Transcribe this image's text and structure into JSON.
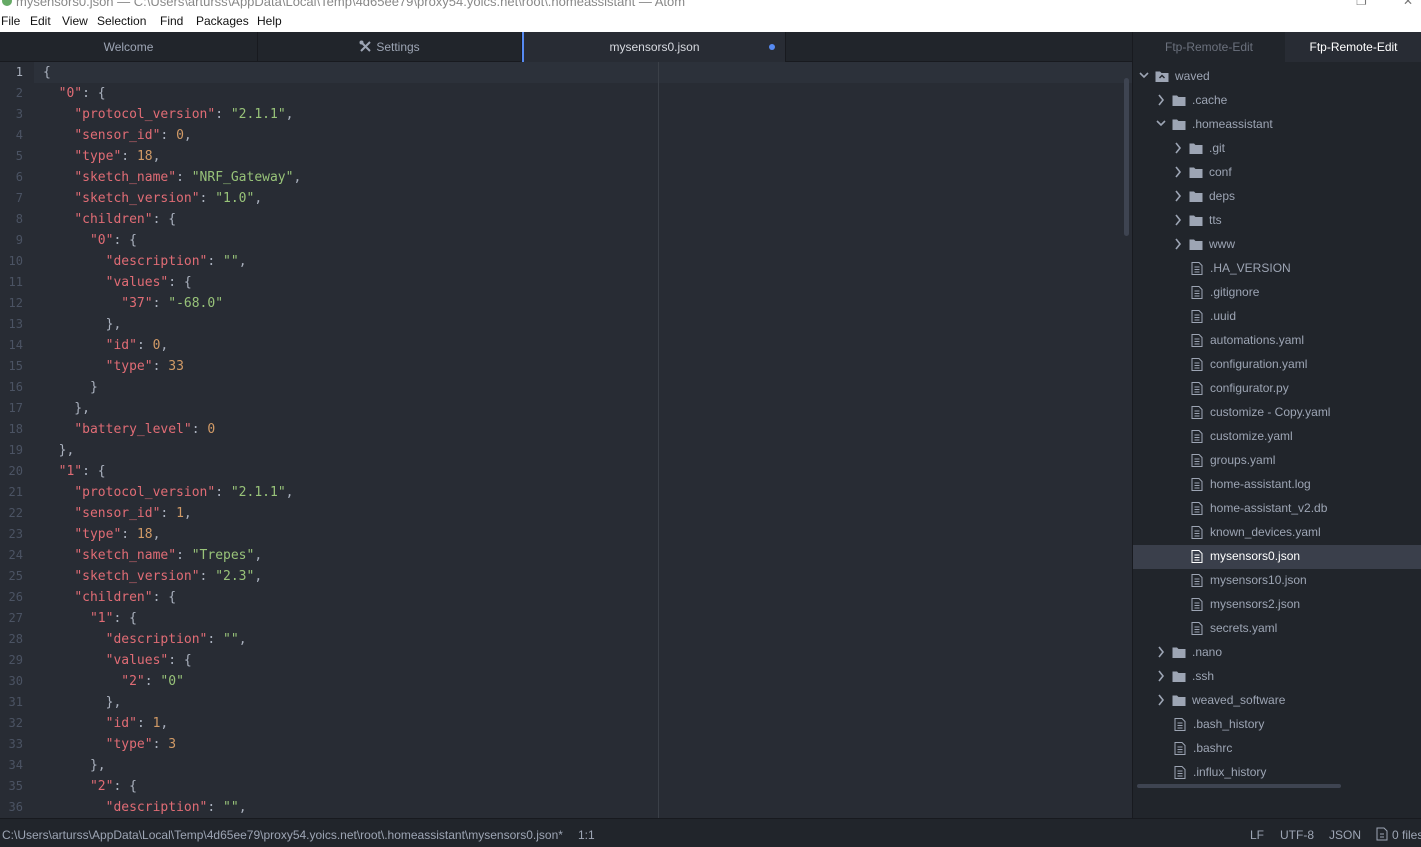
{
  "window": {
    "title": "mysensors0.json — C:\\Users\\arturss\\AppData\\Local\\Temp\\4d65ee79\\proxy54.yoics.net\\root\\.homeassistant — Atom"
  },
  "menu": [
    "File",
    "Edit",
    "View",
    "Selection",
    "Find",
    "Packages",
    "Help"
  ],
  "tabs": [
    {
      "label": "Welcome"
    },
    {
      "label": "Settings",
      "icon": "settings-tools-icon"
    },
    {
      "label": "mysensors0.json",
      "modified": true
    }
  ],
  "editor": {
    "lines": [
      [
        [
          "p",
          "{"
        ]
      ],
      [
        [
          "p",
          "  "
        ],
        [
          "k",
          "\"0\""
        ],
        [
          "p",
          ": {"
        ]
      ],
      [
        [
          "p",
          "    "
        ],
        [
          "k",
          "\"protocol_version\""
        ],
        [
          "p",
          ": "
        ],
        [
          "s",
          "\"2.1.1\""
        ],
        [
          "p",
          ","
        ]
      ],
      [
        [
          "p",
          "    "
        ],
        [
          "k",
          "\"sensor_id\""
        ],
        [
          "p",
          ": "
        ],
        [
          "n",
          "0"
        ],
        [
          "p",
          ","
        ]
      ],
      [
        [
          "p",
          "    "
        ],
        [
          "k",
          "\"type\""
        ],
        [
          "p",
          ": "
        ],
        [
          "n",
          "18"
        ],
        [
          "p",
          ","
        ]
      ],
      [
        [
          "p",
          "    "
        ],
        [
          "k",
          "\"sketch_name\""
        ],
        [
          "p",
          ": "
        ],
        [
          "s",
          "\"NRF_Gateway\""
        ],
        [
          "p",
          ","
        ]
      ],
      [
        [
          "p",
          "    "
        ],
        [
          "k",
          "\"sketch_version\""
        ],
        [
          "p",
          ": "
        ],
        [
          "s",
          "\"1.0\""
        ],
        [
          "p",
          ","
        ]
      ],
      [
        [
          "p",
          "    "
        ],
        [
          "k",
          "\"children\""
        ],
        [
          "p",
          ": {"
        ]
      ],
      [
        [
          "p",
          "      "
        ],
        [
          "k",
          "\"0\""
        ],
        [
          "p",
          ": {"
        ]
      ],
      [
        [
          "p",
          "        "
        ],
        [
          "k",
          "\"description\""
        ],
        [
          "p",
          ": "
        ],
        [
          "s",
          "\"\""
        ],
        [
          "p",
          ","
        ]
      ],
      [
        [
          "p",
          "        "
        ],
        [
          "k",
          "\"values\""
        ],
        [
          "p",
          ": {"
        ]
      ],
      [
        [
          "p",
          "          "
        ],
        [
          "k",
          "\"37\""
        ],
        [
          "p",
          ": "
        ],
        [
          "s",
          "\"-68.0\""
        ]
      ],
      [
        [
          "p",
          "        },"
        ]
      ],
      [
        [
          "p",
          "        "
        ],
        [
          "k",
          "\"id\""
        ],
        [
          "p",
          ": "
        ],
        [
          "n",
          "0"
        ],
        [
          "p",
          ","
        ]
      ],
      [
        [
          "p",
          "        "
        ],
        [
          "k",
          "\"type\""
        ],
        [
          "p",
          ": "
        ],
        [
          "n",
          "33"
        ]
      ],
      [
        [
          "p",
          "      }"
        ]
      ],
      [
        [
          "p",
          "    },"
        ]
      ],
      [
        [
          "p",
          "    "
        ],
        [
          "k",
          "\"battery_level\""
        ],
        [
          "p",
          ": "
        ],
        [
          "n",
          "0"
        ]
      ],
      [
        [
          "p",
          "  },"
        ]
      ],
      [
        [
          "p",
          "  "
        ],
        [
          "k",
          "\"1\""
        ],
        [
          "p",
          ": {"
        ]
      ],
      [
        [
          "p",
          "    "
        ],
        [
          "k",
          "\"protocol_version\""
        ],
        [
          "p",
          ": "
        ],
        [
          "s",
          "\"2.1.1\""
        ],
        [
          "p",
          ","
        ]
      ],
      [
        [
          "p",
          "    "
        ],
        [
          "k",
          "\"sensor_id\""
        ],
        [
          "p",
          ": "
        ],
        [
          "n",
          "1"
        ],
        [
          "p",
          ","
        ]
      ],
      [
        [
          "p",
          "    "
        ],
        [
          "k",
          "\"type\""
        ],
        [
          "p",
          ": "
        ],
        [
          "n",
          "18"
        ],
        [
          "p",
          ","
        ]
      ],
      [
        [
          "p",
          "    "
        ],
        [
          "k",
          "\"sketch_name\""
        ],
        [
          "p",
          ": "
        ],
        [
          "s",
          "\"Trepes\""
        ],
        [
          "p",
          ","
        ]
      ],
      [
        [
          "p",
          "    "
        ],
        [
          "k",
          "\"sketch_version\""
        ],
        [
          "p",
          ": "
        ],
        [
          "s",
          "\"2.3\""
        ],
        [
          "p",
          ","
        ]
      ],
      [
        [
          "p",
          "    "
        ],
        [
          "k",
          "\"children\""
        ],
        [
          "p",
          ": {"
        ]
      ],
      [
        [
          "p",
          "      "
        ],
        [
          "k",
          "\"1\""
        ],
        [
          "p",
          ": {"
        ]
      ],
      [
        [
          "p",
          "        "
        ],
        [
          "k",
          "\"description\""
        ],
        [
          "p",
          ": "
        ],
        [
          "s",
          "\"\""
        ],
        [
          "p",
          ","
        ]
      ],
      [
        [
          "p",
          "        "
        ],
        [
          "k",
          "\"values\""
        ],
        [
          "p",
          ": {"
        ]
      ],
      [
        [
          "p",
          "          "
        ],
        [
          "k",
          "\"2\""
        ],
        [
          "p",
          ": "
        ],
        [
          "s",
          "\"0\""
        ]
      ],
      [
        [
          "p",
          "        },"
        ]
      ],
      [
        [
          "p",
          "        "
        ],
        [
          "k",
          "\"id\""
        ],
        [
          "p",
          ": "
        ],
        [
          "n",
          "1"
        ],
        [
          "p",
          ","
        ]
      ],
      [
        [
          "p",
          "        "
        ],
        [
          "k",
          "\"type\""
        ],
        [
          "p",
          ": "
        ],
        [
          "n",
          "3"
        ]
      ],
      [
        [
          "p",
          "      },"
        ]
      ],
      [
        [
          "p",
          "      "
        ],
        [
          "k",
          "\"2\""
        ],
        [
          "p",
          ": {"
        ]
      ],
      [
        [
          "p",
          "        "
        ],
        [
          "k",
          "\"description\""
        ],
        [
          "p",
          ": "
        ],
        [
          "s",
          "\"\""
        ],
        [
          "p",
          ","
        ]
      ]
    ]
  },
  "tree": {
    "tabs": [
      {
        "label": "Ftp-Remote-Edit"
      },
      {
        "label": "Ftp-Remote-Edit",
        "active": true
      }
    ],
    "items": [
      {
        "label": "waved",
        "kind": "server",
        "depth": 0,
        "expanded": true
      },
      {
        "label": ".cache",
        "kind": "folder",
        "depth": 1,
        "expanded": false
      },
      {
        "label": ".homeassistant",
        "kind": "folder",
        "depth": 1,
        "expanded": true
      },
      {
        "label": ".git",
        "kind": "folder",
        "depth": 2,
        "expanded": false
      },
      {
        "label": "conf",
        "kind": "folder",
        "depth": 2,
        "expanded": false
      },
      {
        "label": "deps",
        "kind": "folder",
        "depth": 2,
        "expanded": false
      },
      {
        "label": "tts",
        "kind": "folder",
        "depth": 2,
        "expanded": false
      },
      {
        "label": "www",
        "kind": "folder",
        "depth": 2,
        "expanded": false
      },
      {
        "label": ".HA_VERSION",
        "kind": "file",
        "depth": 2
      },
      {
        "label": ".gitignore",
        "kind": "file",
        "depth": 2
      },
      {
        "label": ".uuid",
        "kind": "file",
        "depth": 2
      },
      {
        "label": "automations.yaml",
        "kind": "file",
        "depth": 2
      },
      {
        "label": "configuration.yaml",
        "kind": "file",
        "depth": 2
      },
      {
        "label": "configurator.py",
        "kind": "file",
        "depth": 2
      },
      {
        "label": "customize - Copy.yaml",
        "kind": "file",
        "depth": 2
      },
      {
        "label": "customize.yaml",
        "kind": "file",
        "depth": 2
      },
      {
        "label": "groups.yaml",
        "kind": "file",
        "depth": 2
      },
      {
        "label": "home-assistant.log",
        "kind": "file",
        "depth": 2
      },
      {
        "label": "home-assistant_v2.db",
        "kind": "file",
        "depth": 2
      },
      {
        "label": "known_devices.yaml",
        "kind": "file",
        "depth": 2
      },
      {
        "label": "mysensors0.json",
        "kind": "file",
        "depth": 2,
        "selected": true
      },
      {
        "label": "mysensors10.json",
        "kind": "file",
        "depth": 2
      },
      {
        "label": "mysensors2.json",
        "kind": "file",
        "depth": 2
      },
      {
        "label": "secrets.yaml",
        "kind": "file",
        "depth": 2
      },
      {
        "label": ".nano",
        "kind": "folder",
        "depth": 1,
        "expanded": false
      },
      {
        "label": ".ssh",
        "kind": "folder",
        "depth": 1,
        "expanded": false
      },
      {
        "label": "weaved_software",
        "kind": "folder",
        "depth": 1,
        "expanded": false
      },
      {
        "label": ".bash_history",
        "kind": "file",
        "depth": 1
      },
      {
        "label": ".bashrc",
        "kind": "file",
        "depth": 1
      },
      {
        "label": ".influx_history",
        "kind": "file",
        "depth": 1
      }
    ]
  },
  "status": {
    "path": "C:\\Users\\arturss\\AppData\\Local\\Temp\\4d65ee79\\proxy54.yoics.net\\root\\.homeassistant\\mysensors0.json*",
    "cursor": "1:1",
    "line_ending": "LF",
    "encoding": "UTF-8",
    "grammar": "JSON",
    "files": "0 files"
  },
  "colors": {
    "accent": "#568af2",
    "key": "#e06c75",
    "string": "#98c379",
    "number": "#d19a66"
  }
}
